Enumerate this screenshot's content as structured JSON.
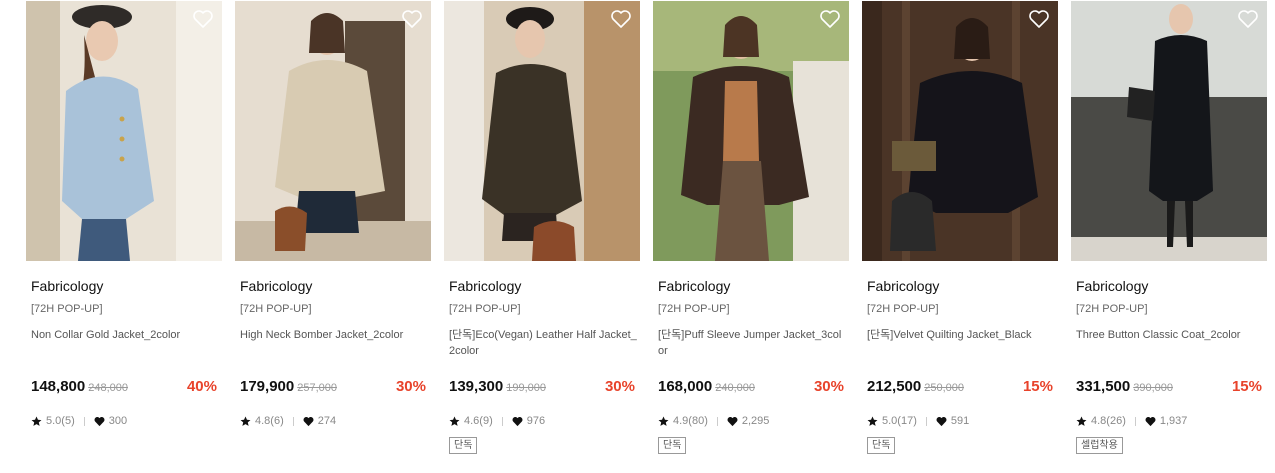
{
  "products": [
    {
      "brand": "Fabricology",
      "tag": "[72H POP-UP]",
      "name": "Non Collar Gold Jacket_2color",
      "price": "148,800",
      "original_price": "248,000",
      "discount": "40%",
      "rating": "5.0(5)",
      "likes": "300",
      "badge": ""
    },
    {
      "brand": "Fabricology",
      "tag": "[72H POP-UP]",
      "name": "High Neck Bomber Jacket_2color",
      "price": "179,900",
      "original_price": "257,000",
      "discount": "30%",
      "rating": "4.8(6)",
      "likes": "274",
      "badge": ""
    },
    {
      "brand": "Fabricology",
      "tag": "[72H POP-UP]",
      "name": "[단독]Eco(Vegan) Leather Half Jacket_2color",
      "price": "139,300",
      "original_price": "199,000",
      "discount": "30%",
      "rating": "4.6(9)",
      "likes": "976",
      "badge": "단독"
    },
    {
      "brand": "Fabricology",
      "tag": "[72H POP-UP]",
      "name": "[단독]Puff Sleeve Jumper Jacket_3color",
      "price": "168,000",
      "original_price": "240,000",
      "discount": "30%",
      "rating": "4.9(80)",
      "likes": "2,295",
      "badge": "단독"
    },
    {
      "brand": "Fabricology",
      "tag": "[72H POP-UP]",
      "name": "[단독]Velvet Quilting Jacket_Black",
      "price": "212,500",
      "original_price": "250,000",
      "discount": "15%",
      "rating": "5.0(17)",
      "likes": "591",
      "badge": "단독"
    },
    {
      "brand": "Fabricology",
      "tag": "[72H POP-UP]",
      "name": "Three Button Classic Coat_2color",
      "price": "331,500",
      "original_price": "390,000",
      "discount": "15%",
      "rating": "4.8(26)",
      "likes": "1,937",
      "badge": "셀럽착용"
    }
  ],
  "colors": {
    "discount": "#e8432b",
    "text": "#111111",
    "muted": "#888888"
  },
  "icons": {
    "wishlist": "heart-outline-icon",
    "rating": "star-icon",
    "likes": "heart-filled-icon"
  }
}
